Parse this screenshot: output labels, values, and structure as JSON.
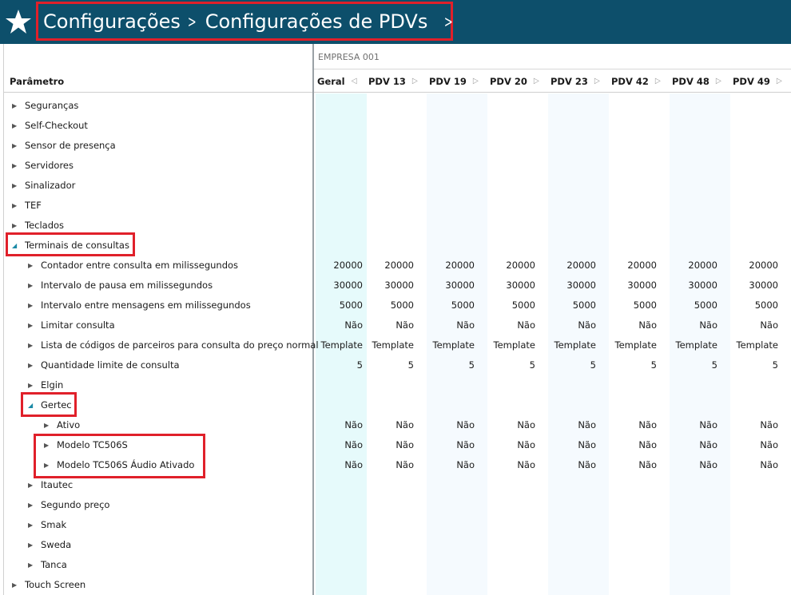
{
  "header": {
    "breadcrumb": [
      "Configurações",
      "Configurações de PDVs"
    ],
    "background_color": "#0d4f6b",
    "highlight_color": "#e0202a",
    "home_icon": "star-icon",
    "nav_icon": "chevron-right-icon"
  },
  "grid": {
    "company": "EMPRESA 001",
    "param_header": "Parâmetro",
    "columns": [
      "Geral",
      "PDV 13",
      "PDV 19",
      "PDV 20",
      "PDV 23",
      "PDV 42",
      "PDV 48",
      "PDV 49"
    ],
    "rows": [
      {
        "label": "Seguranças",
        "level": 0,
        "expanded": false,
        "values": []
      },
      {
        "label": "Self-Checkout",
        "level": 0,
        "expanded": false,
        "values": []
      },
      {
        "label": "Sensor de presença",
        "level": 0,
        "expanded": false,
        "values": []
      },
      {
        "label": "Servidores",
        "level": 0,
        "expanded": false,
        "values": []
      },
      {
        "label": "Sinalizador",
        "level": 0,
        "expanded": false,
        "values": []
      },
      {
        "label": "TEF",
        "level": 0,
        "expanded": false,
        "values": []
      },
      {
        "label": "Teclados",
        "level": 0,
        "expanded": false,
        "values": []
      },
      {
        "label": "Terminais de consultas",
        "level": 0,
        "expanded": true,
        "values": []
      },
      {
        "label": "Contador entre consulta em milissegundos",
        "level": 1,
        "expanded": false,
        "values": [
          "20000",
          "20000",
          "20000",
          "20000",
          "20000",
          "20000",
          "20000",
          "20000"
        ]
      },
      {
        "label": "Intervalo de pausa em milissegundos",
        "level": 1,
        "expanded": false,
        "values": [
          "30000",
          "30000",
          "30000",
          "30000",
          "30000",
          "30000",
          "30000",
          "30000"
        ]
      },
      {
        "label": "Intervalo entre mensagens em milissegundos",
        "level": 1,
        "expanded": false,
        "values": [
          "5000",
          "5000",
          "5000",
          "5000",
          "5000",
          "5000",
          "5000",
          "5000"
        ]
      },
      {
        "label": "Limitar consulta",
        "level": 1,
        "expanded": false,
        "values": [
          "Não",
          "Não",
          "Não",
          "Não",
          "Não",
          "Não",
          "Não",
          "Não"
        ]
      },
      {
        "label": "Lista de códigos de parceiros para consulta do preço normal",
        "level": 1,
        "expanded": false,
        "values": [
          "Template",
          "Template",
          "Template",
          "Template",
          "Template",
          "Template",
          "Template",
          "Template"
        ]
      },
      {
        "label": "Quantidade limite de consulta",
        "level": 1,
        "expanded": false,
        "values": [
          "5",
          "5",
          "5",
          "5",
          "5",
          "5",
          "5",
          "5"
        ]
      },
      {
        "label": "Elgin",
        "level": 1,
        "expanded": false,
        "values": []
      },
      {
        "label": "Gertec",
        "level": 1,
        "expanded": true,
        "values": []
      },
      {
        "label": "Ativo",
        "level": 2,
        "expanded": false,
        "values": [
          "Não",
          "Não",
          "Não",
          "Não",
          "Não",
          "Não",
          "Não",
          "Não"
        ]
      },
      {
        "label": "Modelo TC506S",
        "level": 2,
        "expanded": false,
        "values": [
          "Não",
          "Não",
          "Não",
          "Não",
          "Não",
          "Não",
          "Não",
          "Não"
        ]
      },
      {
        "label": "Modelo TC506S Áudio Ativado",
        "level": 2,
        "expanded": false,
        "values": [
          "Não",
          "Não",
          "Não",
          "Não",
          "Não",
          "Não",
          "Não",
          "Não"
        ]
      },
      {
        "label": "Itautec",
        "level": 1,
        "expanded": false,
        "values": []
      },
      {
        "label": "Segundo preço",
        "level": 1,
        "expanded": false,
        "values": []
      },
      {
        "label": "Smak",
        "level": 1,
        "expanded": false,
        "values": []
      },
      {
        "label": "Sweda",
        "level": 1,
        "expanded": false,
        "values": []
      },
      {
        "label": "Tanca",
        "level": 1,
        "expanded": false,
        "values": []
      },
      {
        "label": "Touch Screen",
        "level": 0,
        "expanded": false,
        "values": []
      }
    ]
  }
}
